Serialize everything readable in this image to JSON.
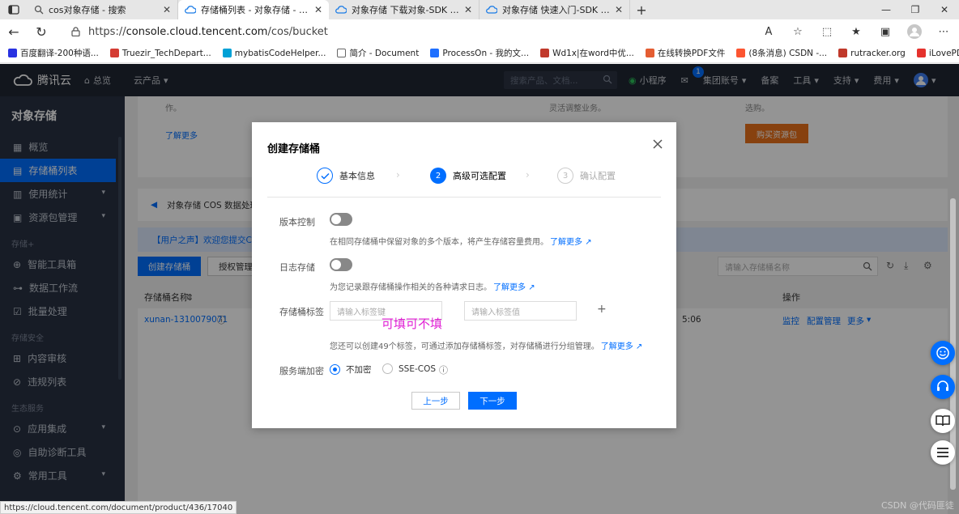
{
  "browser": {
    "tabs": [
      {
        "title": "cos对象存储 - 搜索",
        "active": false,
        "icon": "search-icon"
      },
      {
        "title": "存储桶列表 - 对象存储 - 控制台",
        "active": true,
        "icon": "cloud-icon"
      },
      {
        "title": "对象存储 下载对象-SDK 文档-文",
        "active": false,
        "icon": "cloud-icon"
      },
      {
        "title": "对象存储 快速入门-SDK 文档-文",
        "active": false,
        "icon": "cloud-icon"
      }
    ],
    "new_tab": "+",
    "url_scheme": "https://",
    "url_host": "console.cloud.tencent.com",
    "url_path": "/cos/bucket",
    "bookmarks": [
      {
        "label": "百度翻译-200种语...",
        "color": "#2932e1"
      },
      {
        "label": "Truezir_TechDepart...",
        "color": "#d43c33"
      },
      {
        "label": "mybatisCodeHelper...",
        "color": "#00a1d6"
      },
      {
        "label": "简介 - Document",
        "color": "#666666"
      },
      {
        "label": "ProcessOn - 我的文...",
        "color": "#1e6fff"
      },
      {
        "label": "Wd1x|在word中优...",
        "color": "#c0392b"
      },
      {
        "label": "在线转换PDF文件",
        "color": "#e45d32"
      },
      {
        "label": "(8条消息) CSDN -...",
        "color": "#fc5531"
      },
      {
        "label": "rutracker.org",
        "color": "#c0392b"
      },
      {
        "label": "iLovePDF |面向 PDF...",
        "color": "#e5322d"
      }
    ]
  },
  "header": {
    "brand": "腾讯云",
    "overview": "总览",
    "products": "云产品",
    "search_placeholder": "搜索产品、文档...",
    "mini_program": "小程序",
    "message_count": "1",
    "account": "集团账号",
    "backup": "备案",
    "tools": "工具",
    "support": "支持",
    "billing": "费用"
  },
  "sidebar": {
    "title": "对象存储",
    "items": [
      {
        "label": "概览",
        "icon": "grid-icon"
      },
      {
        "label": "存储桶列表",
        "icon": "bucket-icon",
        "active": true
      },
      {
        "label": "使用统计",
        "icon": "chart-icon",
        "expandable": true
      },
      {
        "label": "资源包管理",
        "icon": "package-icon",
        "expandable": true
      }
    ],
    "group2": "存储+",
    "items2": [
      {
        "label": "智能工具箱",
        "icon": "toolbox-icon"
      },
      {
        "label": "数据工作流",
        "icon": "workflow-icon"
      },
      {
        "label": "批量处理",
        "icon": "batch-icon"
      }
    ],
    "group3": "存储安全",
    "items3": [
      {
        "label": "内容审核",
        "icon": "audit-icon"
      },
      {
        "label": "违规列表",
        "icon": "violation-icon"
      }
    ],
    "group4": "生态服务",
    "items4": [
      {
        "label": "应用集成",
        "icon": "app-icon",
        "expandable": true
      },
      {
        "label": "自助诊断工具",
        "icon": "diagnose-icon"
      },
      {
        "label": "常用工具",
        "icon": "tool-icon",
        "expandable": true
      }
    ]
  },
  "main": {
    "card_text_1": "作。",
    "card_link_1": "了解更多",
    "card_text_2": "灵活调整业务。",
    "card_text_3": "选购。",
    "buy_button": "购买资源包",
    "notice": "对象存储 COS 数据处理",
    "voice": "【用户之声】欢迎您提交COS产",
    "create_bucket": "创建存储桶",
    "auth_manage": "授权管理",
    "bucket_search_placeholder": "请输入存储桶名称",
    "col_name": "存储桶名称",
    "col_ops": "操作",
    "row_name": "xunan-1310079071",
    "row_time": "5:06",
    "op_monitor": "监控",
    "op_config": "配置管理",
    "op_more": "更多"
  },
  "modal": {
    "title": "创建存储桶",
    "steps": [
      {
        "num": "1",
        "label": "基本信息",
        "state": "done"
      },
      {
        "num": "2",
        "label": "高级可选配置",
        "state": "current"
      },
      {
        "num": "3",
        "label": "确认配置",
        "state": "todo"
      }
    ],
    "versioning_label": "版本控制",
    "versioning_on": false,
    "versioning_help": "在相同存储桶中保留对象的多个版本，将产生存储容量费用。",
    "learn_more": "了解更多",
    "logging_label": "日志存储",
    "logging_on": false,
    "logging_help": "为您记录跟存储桶操作相关的各种请求日志。",
    "tags_label": "存储桶标签",
    "tag_key_placeholder": "请输入标签键",
    "tag_value_placeholder": "请输入标签值",
    "tag_add": "+",
    "annotation": "可填可不填",
    "tags_help": "您还可以创建49个标签，可通过添加存储桶标签，对存储桶进行分组管理。",
    "encryption_label": "服务端加密",
    "enc_options": [
      "不加密",
      "SSE-COS"
    ],
    "enc_selected": "不加密",
    "prev_button": "上一步",
    "next_button": "下一步"
  },
  "statusbar": "https://cloud.tencent.com/document/product/436/17040",
  "watermark": "CSDN @代码匪徒"
}
